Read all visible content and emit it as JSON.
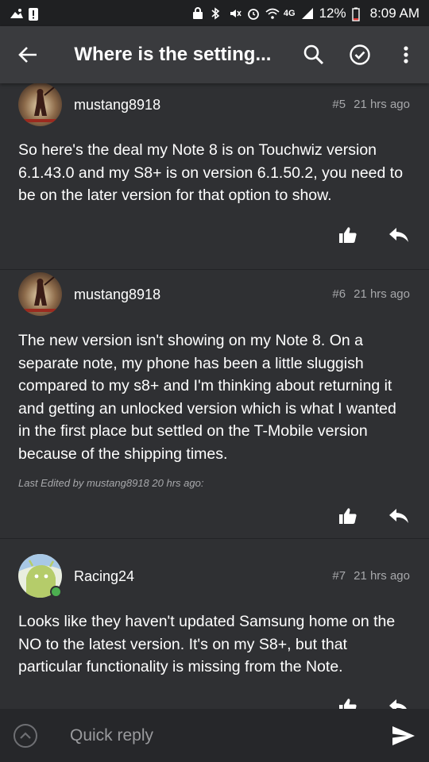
{
  "status_bar": {
    "battery": "12%",
    "time": "8:09 AM",
    "network": "4G"
  },
  "app_bar": {
    "title": "Where is the setting..."
  },
  "posts": [
    {
      "username": "mustang8918",
      "number": "#5",
      "time": "21 hrs ago",
      "body": "So here's the deal my Note 8 is on Touchwiz version 6.1.43.0 and my S8+ is on version 6.1.50.2, you need to be on the later version for that option to show."
    },
    {
      "username": "mustang8918",
      "number": "#6",
      "time": "21 hrs ago",
      "body": "The new version isn't showing on my Note 8. On a separate note, my phone has been a little sluggish compared to my s8+ and I'm thinking about returning it and getting an unlocked version which is what I wanted in the first place but settled on the T-Mobile version because of the shipping times.",
      "edited": "Last Edited by mustang8918 20 hrs ago:"
    },
    {
      "username": "Racing24",
      "number": "#7",
      "time": "21 hrs ago",
      "body": "Looks like they haven't updated Samsung home on the NO to the latest version. It's on my S8+, but that particular functionality is missing from the Note."
    }
  ],
  "reply_bar": {
    "placeholder": "Quick reply"
  },
  "colors": {
    "background": "#2f3033",
    "app_bar": "#3a3b3e",
    "status_bar": "#1f2022",
    "meta_text": "#a7a8ab",
    "online": "#4caf50"
  }
}
